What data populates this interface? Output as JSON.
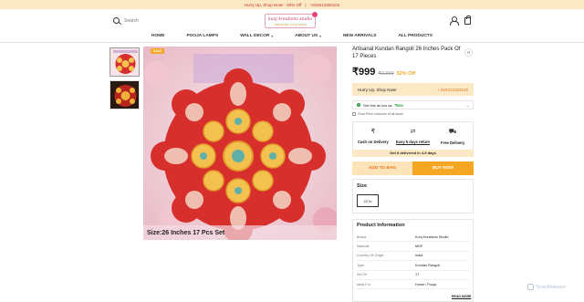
{
  "promo": {
    "left": "Hurry Up, Shop Now! - 50% Off",
    "sep": "|",
    "phone": "+918412363102"
  },
  "header": {
    "search_placeholder": "Search",
    "logo_text": "kunj kreations studio",
    "logo_tagline": "TREASURE YOUR HOME"
  },
  "nav": {
    "items": [
      {
        "label": "HOME",
        "caret": false
      },
      {
        "label": "POOJA LAMPS",
        "caret": false
      },
      {
        "label": "WALL DECOR",
        "caret": true
      },
      {
        "label": "ABOUT US",
        "caret": true
      },
      {
        "label": "NEW ARRIVALS",
        "caret": false
      },
      {
        "label": "ALL PRODUCTS",
        "caret": false
      }
    ]
  },
  "gallery": {
    "badge": "SALE",
    "image_caption": "Size:26 Inches 17 Pcs Set",
    "image_banner_line1": "kunj kreations studio",
    "image_banner_line2": "INDIA · AUSTRALIA · U.S.A"
  },
  "product": {
    "title": "Artisanal Kundan Rangoli 26 Inches Pack Of 17 Pieces",
    "price": "₹999",
    "mrp": "₹2,099",
    "discount": "52% Off",
    "hurry_text": "Hurry Up, Shop Now!",
    "hurry_phone": "+ 918412363102",
    "offer_prefix": "Get this as low as",
    "offer_price": "₹850",
    "final_price_note": "Final Price inclusive of all taxes",
    "features": [
      {
        "icon": "₹",
        "label": "Cash on Delivery",
        "underline": false
      },
      {
        "icon": "⇄",
        "label": "Easy 5 days return",
        "underline": true
      },
      {
        "icon": "⛟",
        "label": "Free Delivery",
        "underline": false
      }
    ],
    "delivery_note": "Get it delivered in 4-9 days",
    "add_to_bag": "ADD TO BAG",
    "buy_now": "BUY NOW",
    "size_label": "Size",
    "size_selected": "22 In",
    "info_title": "Product Information",
    "info_rows": [
      {
        "key": "Brand",
        "value": "Kunj Kreations Studio"
      },
      {
        "key": "Material",
        "value": "MDF"
      },
      {
        "key": "Country Of Origin",
        "value": "India"
      },
      {
        "key": "Type",
        "value": "Kundan Rangoli"
      },
      {
        "key": "Set Of",
        "value": "17"
      },
      {
        "key": "Ideal For",
        "value": "Home / Pooja"
      }
    ],
    "read_more": "READ MORE"
  },
  "watermark": "ScanMalware",
  "colors": {
    "accent": "#f5a623",
    "promo_bg": "#fbe8c4",
    "offer_green": "#2e9e44"
  }
}
